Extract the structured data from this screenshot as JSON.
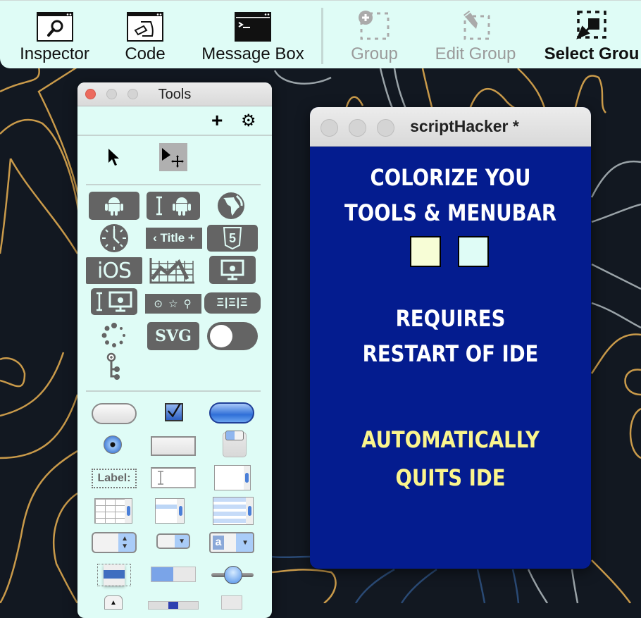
{
  "toolbar": {
    "buttons": [
      {
        "label": "Inspector",
        "icon": "inspector-icon",
        "enabled": true
      },
      {
        "label": "Code",
        "icon": "code-editor-icon",
        "enabled": true
      },
      {
        "label": "Message Box",
        "icon": "message-box-icon",
        "enabled": true
      },
      {
        "label": "Group",
        "icon": "group-icon",
        "enabled": false
      },
      {
        "label": "Edit Group",
        "icon": "edit-group-icon",
        "enabled": false
      },
      {
        "label": "Select Grou",
        "icon": "select-grouped-icon",
        "enabled": true
      }
    ]
  },
  "tools": {
    "title": "Tools",
    "add_label": "+",
    "settings_label": "⚙",
    "widgets": {
      "title_bar_label": "‹ Title +",
      "ios_label": "iOS",
      "svg_label": "SVG",
      "html5_label": "5",
      "label_field_text": "Label:",
      "icon_search_text": "⊙ ☆ ⚲",
      "segmented_text": "Ξ|Ξ|Ξ"
    }
  },
  "script_hacker": {
    "title": "scriptHacker *",
    "line1": "COLORIZE YOU",
    "line2": "TOOLS & MENUBAR",
    "line3": "REQUIRES",
    "line4": "RESTART OF IDE",
    "line5": "AUTOMATICALLY",
    "line6": "QUITS IDE",
    "swatches": [
      {
        "name": "menubar-color",
        "color": "#f7fdd6"
      },
      {
        "name": "tools-color",
        "color": "#dffcf6"
      }
    ],
    "colors": {
      "background": "#041c8f",
      "text": "#ffffff",
      "warning_text": "#fbf58d"
    }
  }
}
